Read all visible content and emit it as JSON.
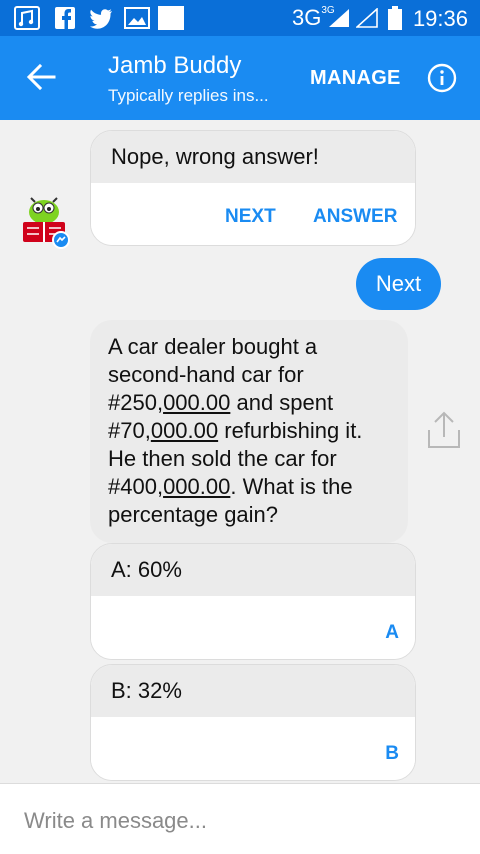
{
  "status_bar": {
    "network": "3G",
    "network_sup": "3G",
    "time": "19:36",
    "notification_icons": [
      "music-icon",
      "facebook-icon",
      "twitter-icon",
      "image-icon",
      "blank-icon"
    ]
  },
  "header": {
    "title": "Jamb Buddy",
    "subtitle": "Typically replies ins...",
    "manage_label": "MANAGE",
    "color": "#1a8bf2"
  },
  "messages": {
    "feedback_card": {
      "text": "Nope, wrong answer!",
      "buttons": [
        "NEXT",
        "ANSWER"
      ]
    },
    "user_reply": "Next",
    "question": {
      "line1": "A car dealer bought a",
      "line2": "second-hand car for",
      "line3a": "#250,",
      "line3u": "000.00",
      "line3b": " and spent",
      "line4a": "#70,",
      "line4u": "000.00",
      "line4b": " refurbishing it.",
      "line5": "He then sold the car for",
      "line6a": "#400,",
      "line6u": "000.00",
      "line6b": ". What is the",
      "line7": "percentage gain?"
    },
    "options": [
      {
        "text": "A: 60%",
        "button": "A"
      },
      {
        "text": "B: 32%",
        "button": "B"
      }
    ]
  },
  "composer": {
    "placeholder": "Write a message..."
  }
}
